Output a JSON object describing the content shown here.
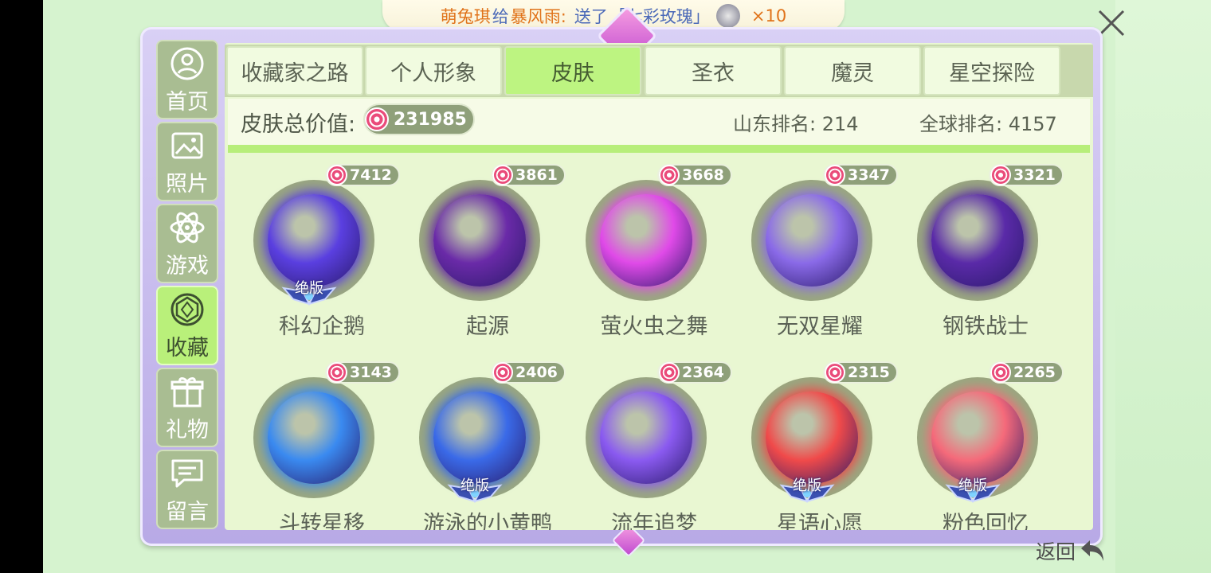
{
  "banner": {
    "sender": "萌兔琪",
    "gave_word": "给",
    "receiver": "暴风雨:",
    "action": "送了",
    "item": "「七彩玫瑰」",
    "qty": "×10"
  },
  "sidebar": {
    "items": [
      {
        "label": "首页",
        "icon": "user-icon"
      },
      {
        "label": "照片",
        "icon": "image-icon"
      },
      {
        "label": "游戏",
        "icon": "atom-icon"
      },
      {
        "label": "收藏",
        "icon": "gem-icon",
        "active": true
      },
      {
        "label": "礼物",
        "icon": "gift-icon"
      },
      {
        "label": "留言",
        "icon": "message-icon"
      }
    ]
  },
  "tabs": [
    {
      "label": "收藏家之路"
    },
    {
      "label": "个人形象"
    },
    {
      "label": "皮肤",
      "active": true
    },
    {
      "label": "圣衣"
    },
    {
      "label": "魔灵"
    },
    {
      "label": "星空探险"
    }
  ],
  "summary": {
    "total_label": "皮肤总价值:",
    "total_value": "231985",
    "province_rank": "山东排名: 214",
    "global_rank": "全球排名: 4157"
  },
  "badge_text": "绝版",
  "skins": [
    {
      "name": "科幻企鹅",
      "price": "7412",
      "limited": true,
      "color": "#5a3fe0"
    },
    {
      "name": "起源",
      "price": "3861",
      "limited": false,
      "color": "#6a2aa8"
    },
    {
      "name": "萤火虫之舞",
      "price": "3668",
      "limited": false,
      "color": "#e04ae8"
    },
    {
      "name": "无双星耀",
      "price": "3347",
      "limited": false,
      "color": "#8a6ae8"
    },
    {
      "name": "钢铁战士",
      "price": "3321",
      "limited": false,
      "color": "#5a2aa8"
    },
    {
      "name": "斗转星移",
      "price": "3143",
      "limited": false,
      "color": "#3a8af0"
    },
    {
      "name": "游泳的小黄鸭",
      "price": "2406",
      "limited": true,
      "color": "#3a6ae8"
    },
    {
      "name": "流年追梦",
      "price": "2364",
      "limited": false,
      "color": "#8a5af0"
    },
    {
      "name": "星语心愿",
      "price": "2315",
      "limited": true,
      "color": "#f04a4a"
    },
    {
      "name": "粉色回忆",
      "price": "2265",
      "limited": true,
      "color": "#f56a7a"
    }
  ],
  "back_label": "返回"
}
